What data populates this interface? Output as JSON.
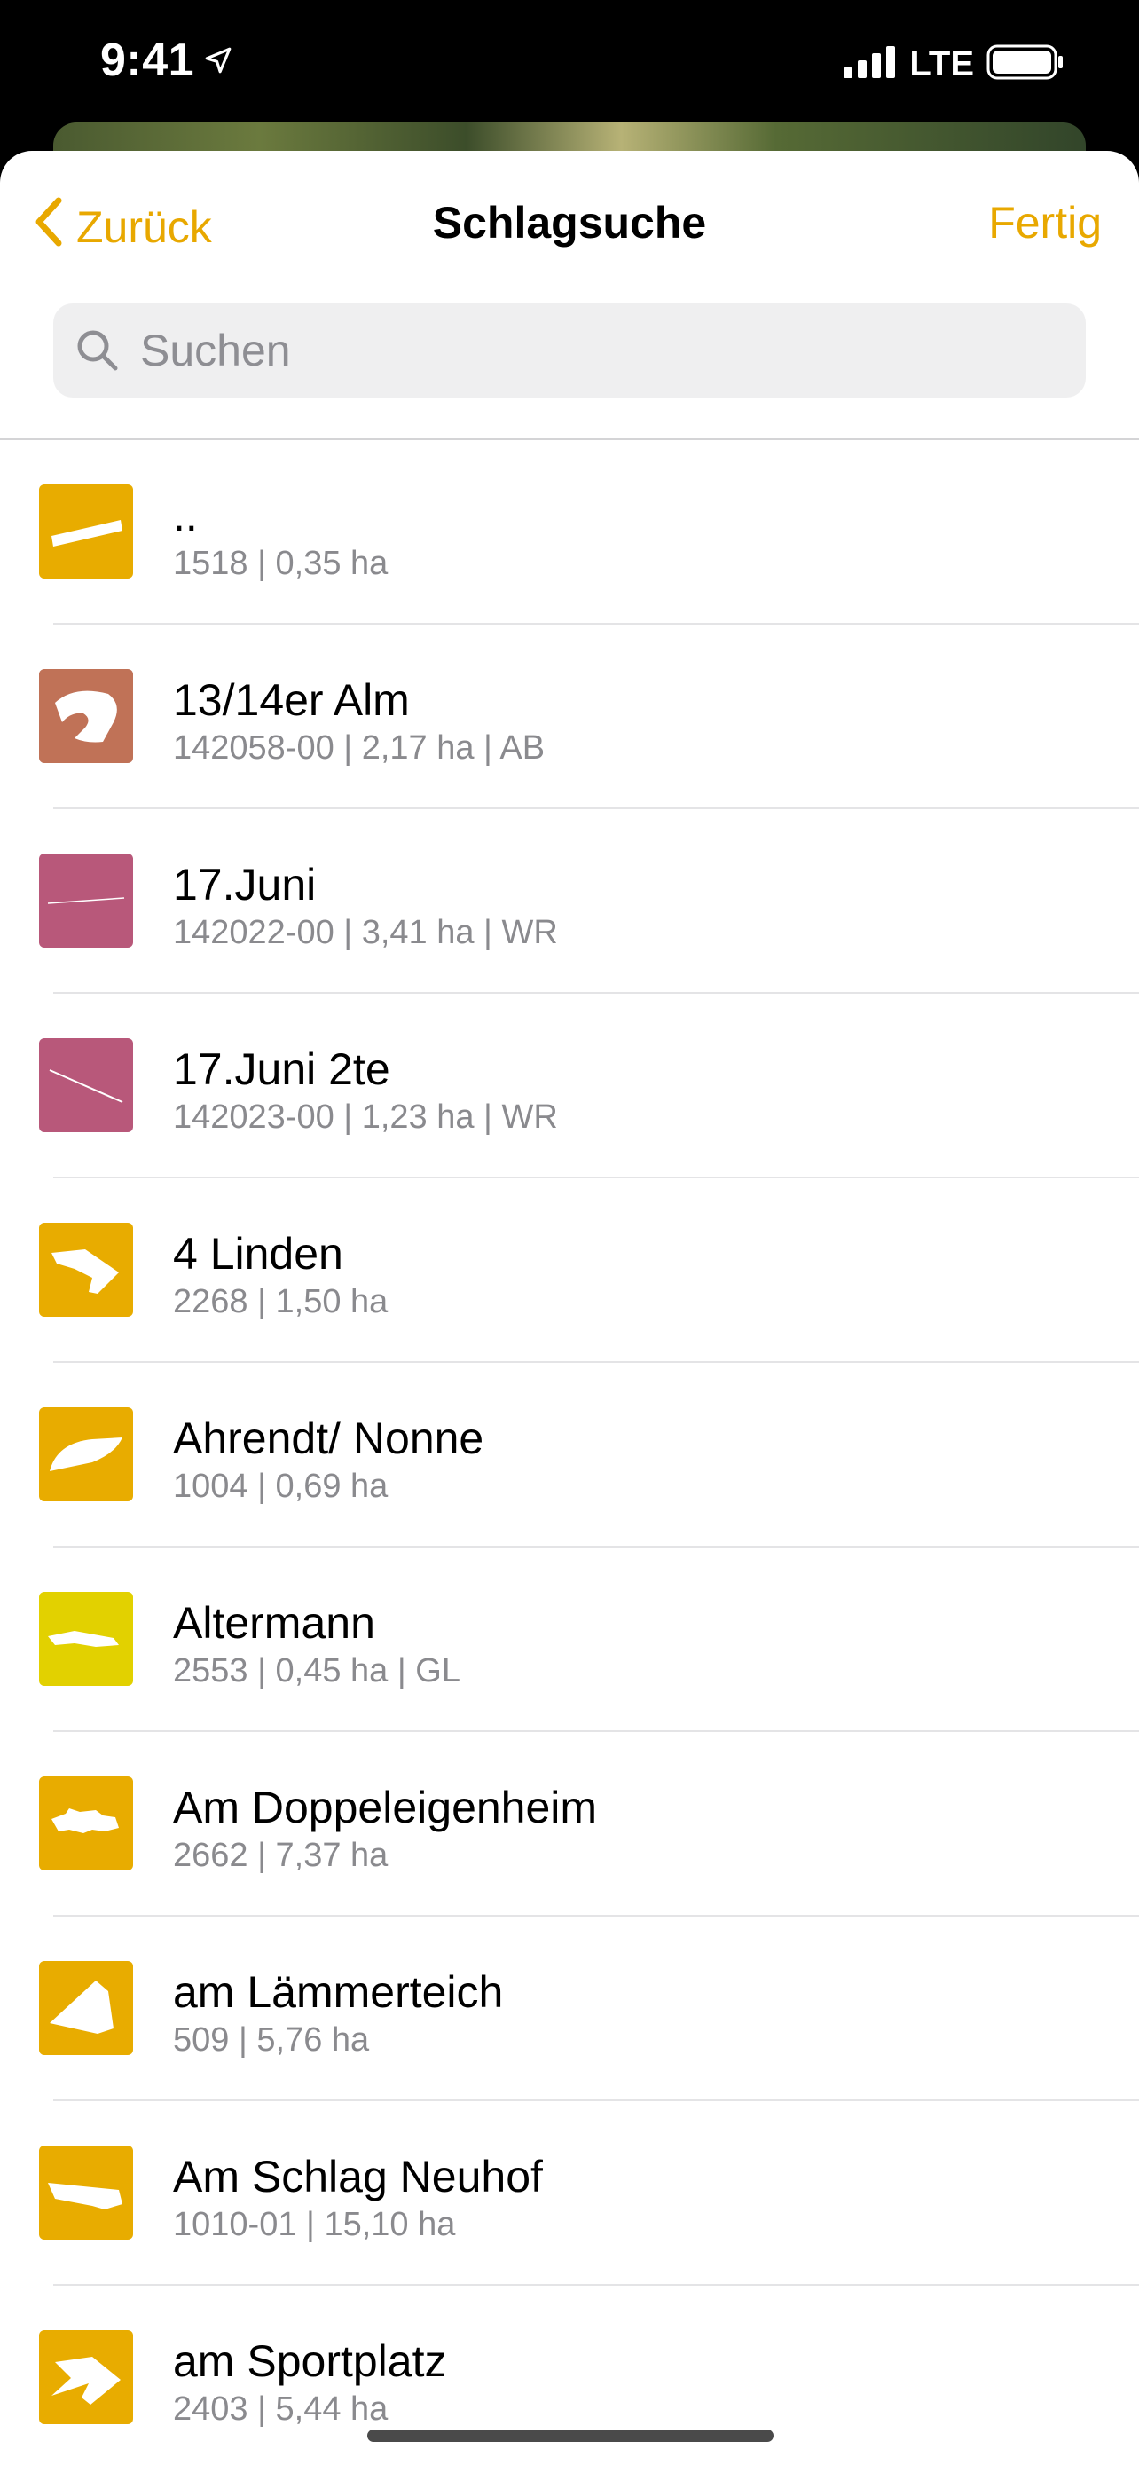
{
  "status_bar": {
    "time": "9:41",
    "network": "LTE"
  },
  "nav": {
    "back_label": "Zurück",
    "title": "Schlagsuche",
    "done_label": "Fertig"
  },
  "search": {
    "placeholder": "Suchen",
    "value": ""
  },
  "colors": {
    "accent": "#e8a800",
    "thumb_yellow": "#e8ac00",
    "thumb_brown": "#c07257",
    "thumb_pink": "#b8587a",
    "thumb_lime": "#e2d100"
  },
  "items": [
    {
      "title": "..",
      "subtitle": "1518 | 0,35 ha",
      "color": "#e8ac00",
      "icon": "field-shape-sliver-icon"
    },
    {
      "title": "13/14er Alm",
      "subtitle": "142058-00 | 2,17 ha | AB",
      "color": "#c07257",
      "icon": "field-shape-hook-icon"
    },
    {
      "title": "17.Juni",
      "subtitle": "142022-00 | 3,41 ha | WR",
      "color": "#b8587a",
      "icon": "field-shape-line-icon"
    },
    {
      "title": "17.Juni 2te",
      "subtitle": "142023-00 | 1,23 ha | WR",
      "color": "#b8587a",
      "icon": "field-shape-diagonal-icon"
    },
    {
      "title": "4 Linden",
      "subtitle": "2268 | 1,50 ha",
      "color": "#e8ac00",
      "icon": "field-shape-arrow-icon"
    },
    {
      "title": "Ahrendt/ Nonne",
      "subtitle": "1004 | 0,69 ha",
      "color": "#e8ac00",
      "icon": "field-shape-wedge-icon"
    },
    {
      "title": "Altermann",
      "subtitle": "2553 | 0,45 ha | GL",
      "color": "#e2d100",
      "icon": "field-shape-strip-icon"
    },
    {
      "title": "Am Doppeleigenheim",
      "subtitle": "2662 | 7,37 ha",
      "color": "#e8ac00",
      "icon": "field-shape-blocks-icon"
    },
    {
      "title": "am Lämmerteich",
      "subtitle": "509 | 5,76 ha",
      "color": "#e8ac00",
      "icon": "field-shape-triangle-icon"
    },
    {
      "title": "Am Schlag Neuhof",
      "subtitle": "1010-01 | 15,10 ha",
      "color": "#e8ac00",
      "icon": "field-shape-band-icon"
    },
    {
      "title": "am Sportplatz",
      "subtitle": "2403 | 5,44 ha",
      "color": "#e8ac00",
      "icon": "field-shape-kite-icon"
    }
  ]
}
